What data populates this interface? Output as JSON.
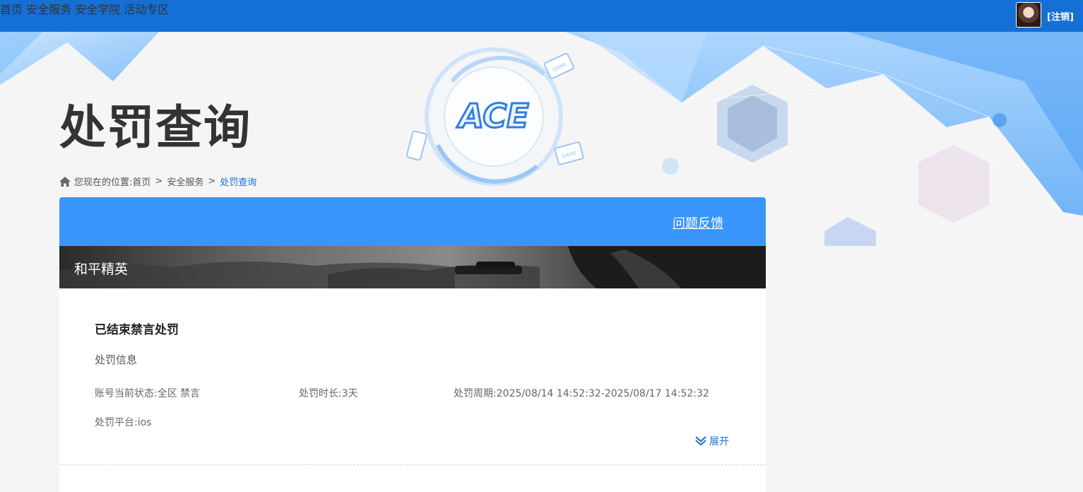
{
  "nav": {
    "items": [
      "首页",
      "安全服务",
      "安全学院",
      "活动专区"
    ],
    "logout_label": "[注销]"
  },
  "hero": {
    "title": "处罚查询",
    "logo_text": "ACE",
    "badge_text": "GAME"
  },
  "breadcrumb": {
    "prefix": "您现在的位置:",
    "items": [
      "首页",
      "安全服务",
      "处罚查询"
    ],
    "separator": ">"
  },
  "card": {
    "feedback_label": "问题反馈",
    "game_name": "和平精英",
    "status_title": "已结束禁言处罚",
    "section_label": "处罚信息",
    "account_status": "账号当前状态:全区 禁言",
    "duration": "处罚时长:3天",
    "period": "处罚周期:2025/08/14 14:52:32-2025/08/17 14:52:32",
    "platform": "处罚平台:ios",
    "expand_label": "展开"
  },
  "colors": {
    "topbar": "#1570d6",
    "card_header": "#3a95fb",
    "accent": "#1570d6"
  },
  "icons": [
    "home-icon",
    "chevron-double-down-icon",
    "avatar"
  ]
}
